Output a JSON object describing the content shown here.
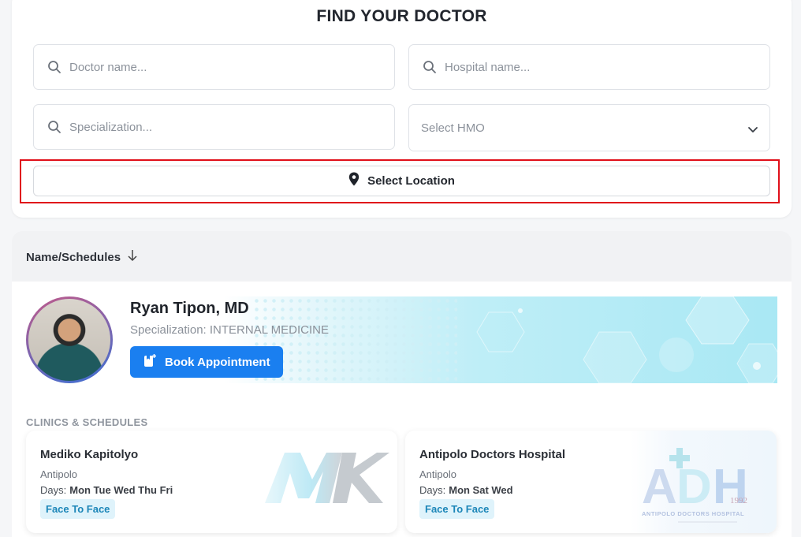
{
  "header": {
    "title": "FIND YOUR DOCTOR"
  },
  "search": {
    "doctor_placeholder": "Doctor name...",
    "hospital_placeholder": "Hospital name...",
    "specialization_placeholder": "Specialization...",
    "hmo_select": "Select HMO",
    "location_button": "Select Location"
  },
  "list": {
    "sort_label": "Name/Schedules"
  },
  "doctor": {
    "name": "Ryan Tipon, MD",
    "specialization": "Specialization: INTERNAL MEDICINE",
    "book_label": "Book Appointment"
  },
  "clinics": {
    "title": "CLINICS & SCHEDULES",
    "items": [
      {
        "name": "Mediko Kapitolyo",
        "city": "Antipolo",
        "days_label": "Days:",
        "days": "Mon Tue Wed Thu Fri",
        "badge": "Face To Face",
        "logo_text": "MK"
      },
      {
        "name": "Antipolo Doctors Hospital",
        "city": "Antipolo",
        "days_label": "Days:",
        "days": "Mon Sat Wed",
        "badge": "Face To Face",
        "logo_text": "ADH",
        "logo_year": "1992",
        "logo_caption": "ANTIPOLO DOCTORS HOSPITAL"
      }
    ]
  },
  "colors": {
    "primary": "#1a7ff0",
    "highlight": "#e0101a",
    "badge_bg": "#dff3fb",
    "badge_text": "#1c86b8"
  }
}
